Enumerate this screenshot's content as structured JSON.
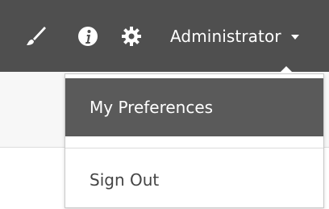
{
  "topbar": {
    "icons": [
      "paintbrush-icon",
      "info-icon",
      "gear-icon"
    ],
    "user_name": "Administrator"
  },
  "user_menu": {
    "items": [
      {
        "label": "My Preferences",
        "state": "highlighted"
      },
      {
        "label": "Sign Out"
      }
    ]
  },
  "colors": {
    "topbar_bg": "#4f4f4f",
    "menu_highlight_bg": "#5a5a5a",
    "icon_fg": "#ffffff"
  }
}
